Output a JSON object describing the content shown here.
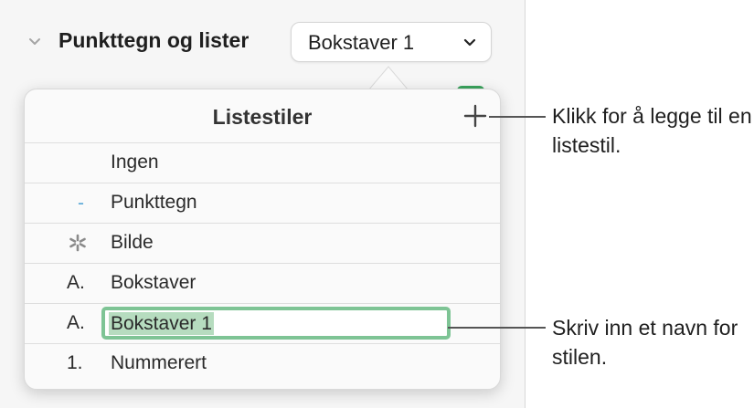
{
  "inspector": {
    "section_title": "Punkttegn og lister",
    "style_popup_value": "Bokstaver 1"
  },
  "popover": {
    "title": "Listestiler",
    "add_icon": "plus-icon",
    "rows": [
      {
        "marker": "",
        "label": "Ingen"
      },
      {
        "marker": "-",
        "label": "Punkttegn",
        "marker_color": "#5aa8d6"
      },
      {
        "marker_icon": "asterisk-image-icon",
        "label": "Bilde"
      },
      {
        "marker": "A.",
        "label": "Bokstaver"
      },
      {
        "marker": "A.",
        "label": "Bokstaver 1",
        "editing": true
      },
      {
        "marker": "1.",
        "label": "Nummerert"
      }
    ]
  },
  "callouts": {
    "add_style": "Klikk for å legge til en listestil.",
    "name_style": "Skriv inn et navn for stilen."
  },
  "colors": {
    "field_focus": "#7ec495",
    "selection": "#b6dcbf",
    "bullet": "#5aa8d6"
  }
}
